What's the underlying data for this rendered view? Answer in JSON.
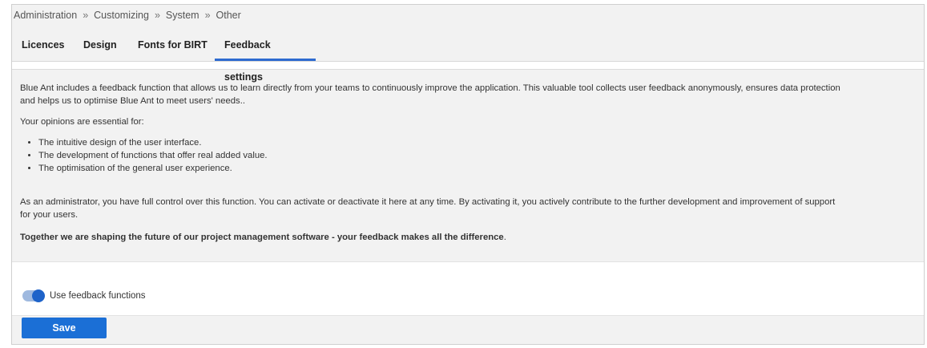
{
  "breadcrumb": {
    "items": [
      "Administration",
      "Customizing",
      "System",
      "Other"
    ],
    "separator": "»"
  },
  "tabs": [
    {
      "label": "Licences",
      "active": false
    },
    {
      "label": "Design",
      "active": false
    },
    {
      "label": "Fonts for BIRT",
      "active": false
    },
    {
      "label": "Feedback settings",
      "active": true
    }
  ],
  "description": {
    "intro_line1": "Blue Ant includes a feedback function that allows us to learn directly from your teams to continuously improve the application. This valuable tool collects user feedback anonymously, ensures data protection",
    "intro_line2": "and helps us to optimise Blue Ant to meet users' needs..",
    "opinions_heading": "Your opinions are essential for:",
    "bullets": [
      "The intuitive design of the user interface.",
      "The development of functions that offer real added value.",
      "The optimisation of the general user experience."
    ],
    "admin_line1": "As an administrator, you have full control over this function. You can activate or deactivate it here at any time. By activating it, you actively contribute to the further development and improvement of support",
    "admin_line2": "for your users.",
    "closing_bold": "Together we are shaping the future of our project management software - your feedback makes all the difference",
    "closing_end": "."
  },
  "settings": {
    "toggle_label": "Use feedback functions",
    "toggle_on": true
  },
  "actions": {
    "save_label": "Save"
  },
  "colors": {
    "accent": "#1b6fd6",
    "active_tab_underline": "#2e6bd0",
    "panel_background": "#f2f2f2"
  }
}
